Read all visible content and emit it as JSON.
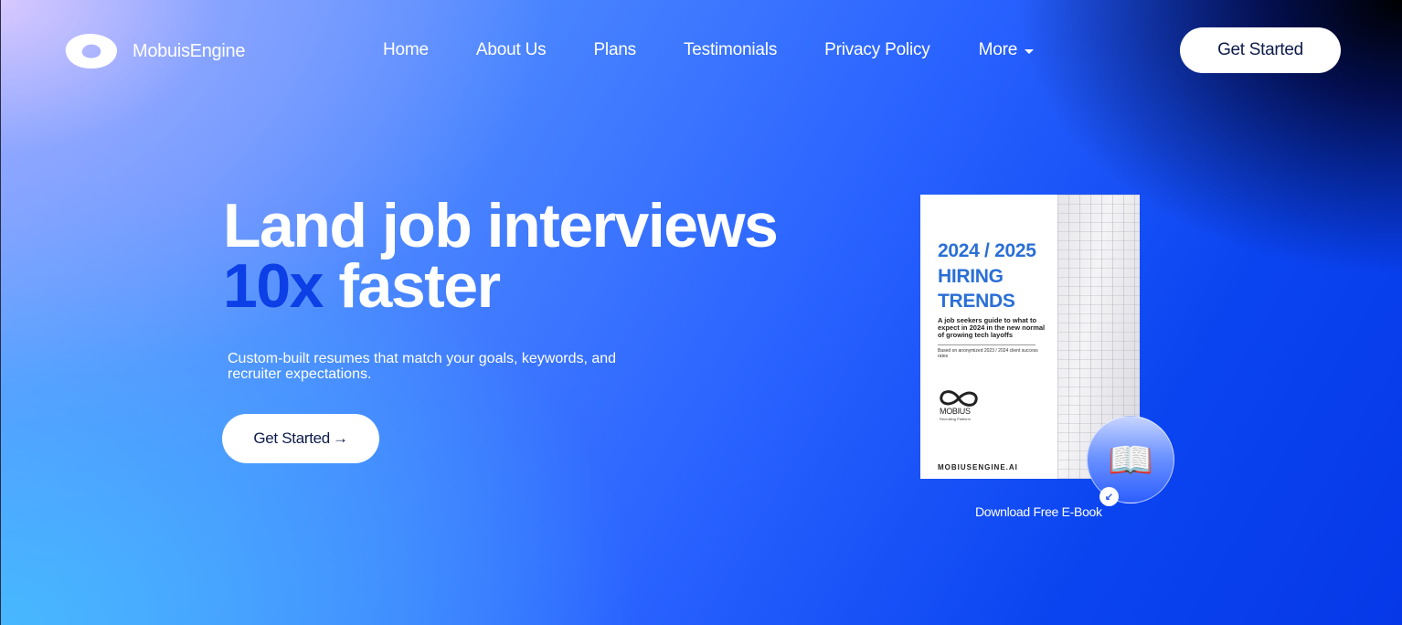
{
  "brand": {
    "name": "MobuisEngine",
    "logo_icon": "ring-logo-icon"
  },
  "nav": {
    "items": [
      {
        "label": "Home"
      },
      {
        "label": "About Us"
      },
      {
        "label": "Plans"
      },
      {
        "label": "Testimonials"
      },
      {
        "label": "Privacy Policy"
      },
      {
        "label": "More"
      }
    ],
    "cta_label": "Get Started"
  },
  "hero": {
    "title_line1": "Land job interviews",
    "title_accent": "10x",
    "title_rest": "faster",
    "subtitle": "Custom-built resumes that match your goals, keywords, and recruiter expectations.",
    "cta_label": "Get Started",
    "cta_arrow": "→"
  },
  "ebook": {
    "cover_title_1": "2024 / 2025",
    "cover_title_2": "HIRING",
    "cover_title_3": "TRENDS",
    "cover_desc": "A job seekers guide to what to expect in 2024 in the new normal of growing tech layoffs",
    "cover_note": "Based on anonymized 2023 / 2024 client success rates",
    "cover_brand": "MOBIUS",
    "cover_brand_sub": "Recruiting Platform",
    "cover_url": "MOBIUSENGINE.AI",
    "book_icon": "📖",
    "download_icon": "↙",
    "download_label": "Download Free E-Book"
  },
  "colors": {
    "accent": "#0c3fe6",
    "cover_title": "#2a6fd6",
    "button_text": "#0d1b4a"
  }
}
